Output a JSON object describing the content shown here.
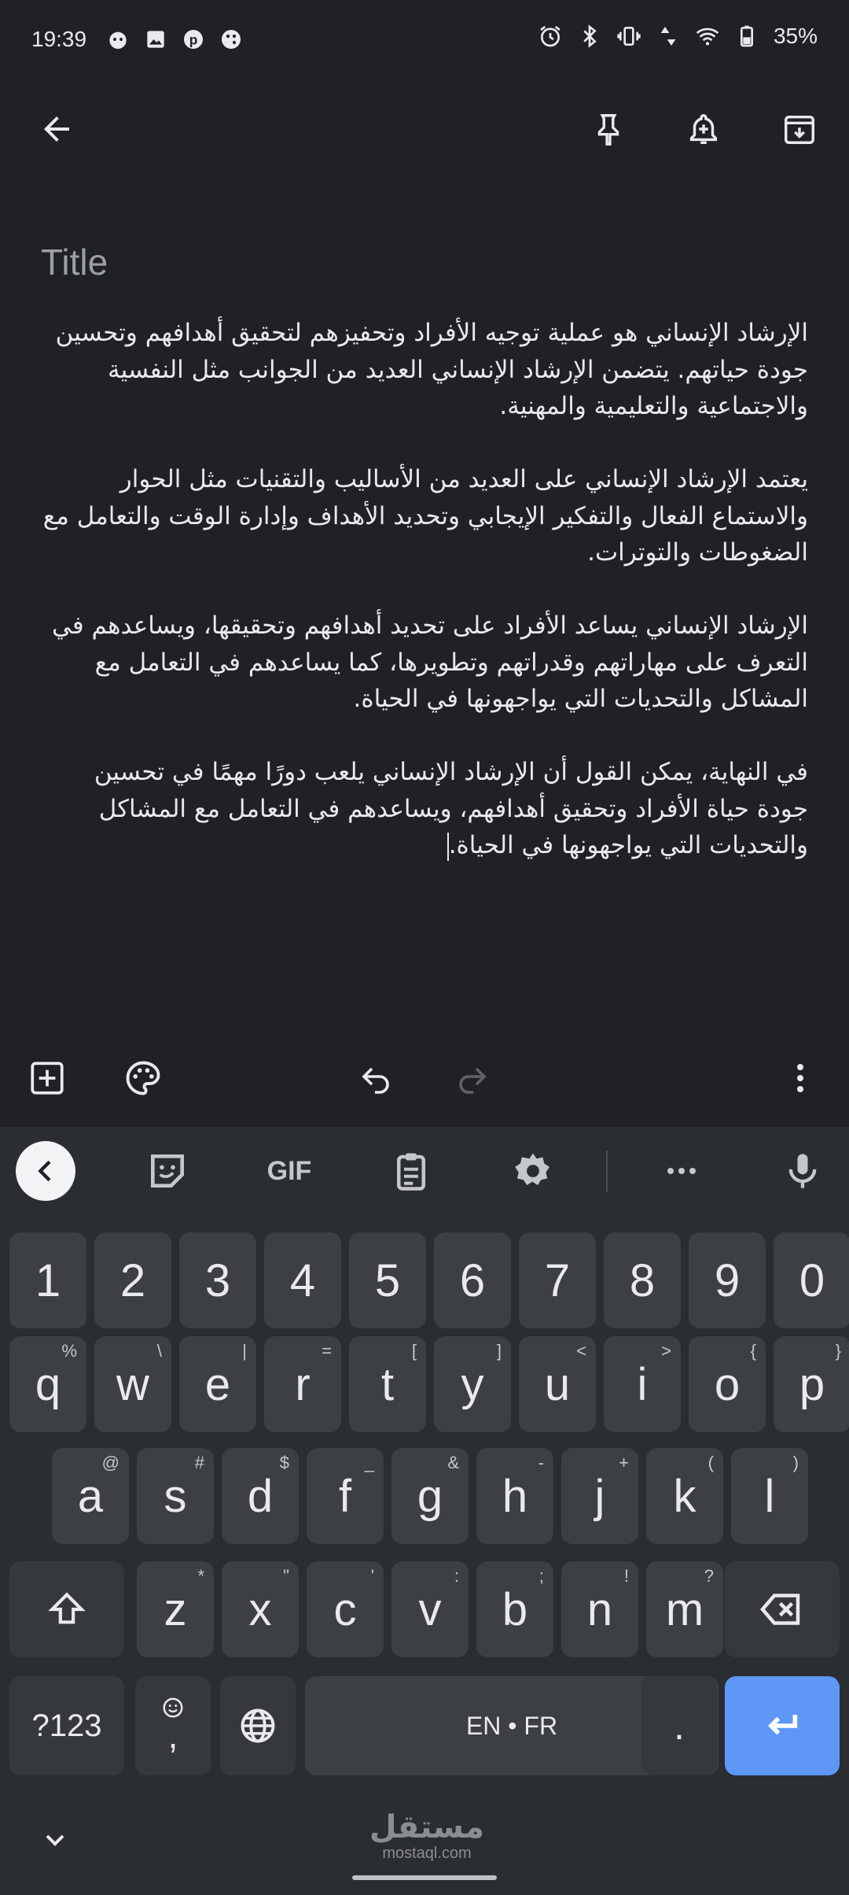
{
  "status_bar": {
    "time": "19:39",
    "battery": "35%",
    "left_icons": [
      "android-debug-icon",
      "image-icon",
      "pinterest-icon",
      "game-icon"
    ],
    "right_icons": [
      "alarm-icon",
      "bluetooth-icon",
      "vibrate-icon",
      "data-arrows-icon",
      "wifi-icon",
      "battery-icon"
    ]
  },
  "app_bar": {
    "back_icon": "arrow-back-icon",
    "actions": [
      "pin-icon",
      "reminder-bell-icon",
      "archive-icon"
    ]
  },
  "note": {
    "title_placeholder": "Title",
    "paragraphs": [
      "الإرشاد الإنساني هو عملية توجيه الأفراد وتحفيزهم لتحقيق أهدافهم وتحسين جودة حياتهم. يتضمن الإرشاد الإنساني العديد من الجوانب مثل النفسية والاجتماعية والتعليمية والمهنية.",
      "يعتمد الإرشاد الإنساني على العديد من الأساليب والتقنيات مثل الحوار والاستماع الفعال والتفكير الإيجابي وتحديد الأهداف وإدارة الوقت والتعامل مع الضغوطات والتوترات.",
      "الإرشاد الإنساني يساعد الأفراد على تحديد أهدافهم وتحقيقها، ويساعدهم في التعرف على مهاراتهم وقدراتهم وتطويرها، كما يساعدهم في التعامل مع المشاكل والتحديات التي يواجهونها في الحياة.",
      "في النهاية، يمكن القول أن الإرشاد الإنساني يلعب دورًا مهمًا في تحسين جودة حياة الأفراد وتحقيق أهدافهم، ويساعدهم في التعامل مع المشاكل والتحديات التي يواجهونها في الحياة."
    ]
  },
  "editor_toolbar": {
    "icons": [
      "add-box-icon",
      "palette-icon",
      "undo-icon",
      "redo-icon",
      "more-vert-icon"
    ]
  },
  "keyboard": {
    "suggestion_strip": {
      "gif_label": "GIF",
      "icons": [
        "collapse-icon",
        "sticker-icon",
        "clipboard-icon",
        "settings-icon",
        "more-horiz-icon",
        "mic-icon"
      ]
    },
    "number_row": [
      "1",
      "2",
      "3",
      "4",
      "5",
      "6",
      "7",
      "8",
      "9",
      "0"
    ],
    "row1": [
      {
        "key": "q",
        "hint": "%"
      },
      {
        "key": "w",
        "hint": "\\"
      },
      {
        "key": "e",
        "hint": "|"
      },
      {
        "key": "r",
        "hint": "="
      },
      {
        "key": "t",
        "hint": "["
      },
      {
        "key": "y",
        "hint": "]"
      },
      {
        "key": "u",
        "hint": "<"
      },
      {
        "key": "i",
        "hint": ">"
      },
      {
        "key": "o",
        "hint": "{"
      },
      {
        "key": "p",
        "hint": "}"
      }
    ],
    "row2": [
      {
        "key": "a",
        "hint": "@"
      },
      {
        "key": "s",
        "hint": "#"
      },
      {
        "key": "d",
        "hint": "$"
      },
      {
        "key": "f",
        "hint": "_"
      },
      {
        "key": "g",
        "hint": "&"
      },
      {
        "key": "h",
        "hint": "-"
      },
      {
        "key": "j",
        "hint": "+"
      },
      {
        "key": "k",
        "hint": "("
      },
      {
        "key": "l",
        "hint": ")"
      }
    ],
    "row3": [
      {
        "key": "z",
        "hint": "*"
      },
      {
        "key": "x",
        "hint": "\""
      },
      {
        "key": "c",
        "hint": "'"
      },
      {
        "key": "v",
        "hint": ":"
      },
      {
        "key": "b",
        "hint": ";"
      },
      {
        "key": "n",
        "hint": "!"
      },
      {
        "key": "m",
        "hint": "?"
      }
    ],
    "symbols_key": "?123",
    "comma_key": ",",
    "space_label": "EN • FR",
    "period_key": "."
  },
  "watermark": {
    "arabic": "مستقل",
    "latin": "mostaql.com"
  },
  "colors": {
    "background": "#202124",
    "keyboard_bg": "#2a2d32",
    "key_bg": "#3c4043",
    "enter_key": "#5e97f6"
  }
}
